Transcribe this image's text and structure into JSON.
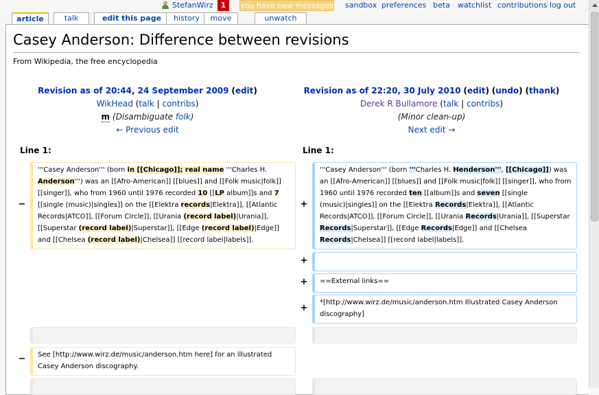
{
  "personal": {
    "username": "StefanWirz",
    "notification_count": "1",
    "new_messages": "you have new messages",
    "links": [
      "sandbox",
      "preferences",
      "beta",
      "watchlist",
      "contributions",
      "log out"
    ]
  },
  "tabs": [
    "article",
    "talk",
    "edit this page",
    "history",
    "move",
    "unwatch"
  ],
  "page": {
    "title": "Casey Anderson: Difference between revisions",
    "tagline": "From Wikipedia, the free encyclopedia"
  },
  "old_rev": {
    "title_link": "Revision as of 20:44, 24 September 2009",
    "edit": "edit",
    "user": "WikHead",
    "talk": "talk",
    "contribs": "contribs",
    "minor": "m",
    "summary_prefix": "Disambiguate ",
    "summary_link": "folk",
    "nav": "← Previous edit"
  },
  "new_rev": {
    "title_link": "Revision as of 22:20, 30 July 2010",
    "edit": "edit",
    "undo": "undo",
    "thank": "thank",
    "user": "Derek R Bullamore",
    "talk": "talk",
    "contribs": "contribs",
    "summary": "Minor clean-up",
    "nav": "Next edit →"
  },
  "diff": {
    "line_label_left": "Line 1:",
    "line_label_right": "Line 1:",
    "minus": "−",
    "plus": "+",
    "del1": [
      "'''Casey Anderson''' (born ",
      "in [[Chicago]]; real name",
      " '''Charles H. ",
      "Anderson",
      "''') was an [[Afro-American]] [[blues]] and [[Folk music|folk]] [[singer]], who from 1960 until 1976 recorded ",
      "10",
      " [[",
      "LP",
      " album]]s and ",
      "7",
      " [[single (music)|singles]] on the [[Elektra ",
      "records",
      "|Elektra]], [[Atlantic Records|ATCO]], [[Forum Circle]], [[Urania ",
      "(record label)",
      "|Urania]], [[Superstar ",
      "(record label)",
      "|Superstar]], [[Edge ",
      "(record label)",
      "|Edge]] and [[Chelsea ",
      "(record label)",
      "|Chelsea]] [[record label|labels]]."
    ],
    "add1": [
      "'''Casey Anderson''' (born ",
      "'''",
      "Charles H. ",
      "Henderson'''",
      ", ",
      "[[Chicago]]",
      ") was an [[Afro-American]] [[blues]] and [[Folk music|folk]] [[singer]], who from 1960 until 1976 recorded ",
      "ten",
      " [[album]]s and ",
      "seven",
      " [[single (music)|singles]] on the [[Elektra ",
      "Records",
      "|Elektra]], [[Atlantic Records|ATCO]], [[Forum Circle]], [[Urania ",
      "Records",
      "|Urania]], [[Superstar ",
      "Records",
      "|Superstar]], [[Edge ",
      "Records",
      "|Edge]] and [[Chelsea ",
      "Records",
      "|Chelsea]] [[record label|labels]]."
    ],
    "add2": "",
    "add3": "==External links==",
    "add4": "*[http://www.wirz.de/music/anderson.htm Illustrated Casey Anderson discography]",
    "del2": "See [http://www.wirz.de/music/anderson.htm here] for an illustrated Casey Anderson discography."
  },
  "colors": {
    "link": "#0645ad",
    "deleted_border": "#ffe49c",
    "added_border": "#a3d3ff",
    "notification": "#cc0000",
    "new_messages_bg": "#f8d27a"
  }
}
